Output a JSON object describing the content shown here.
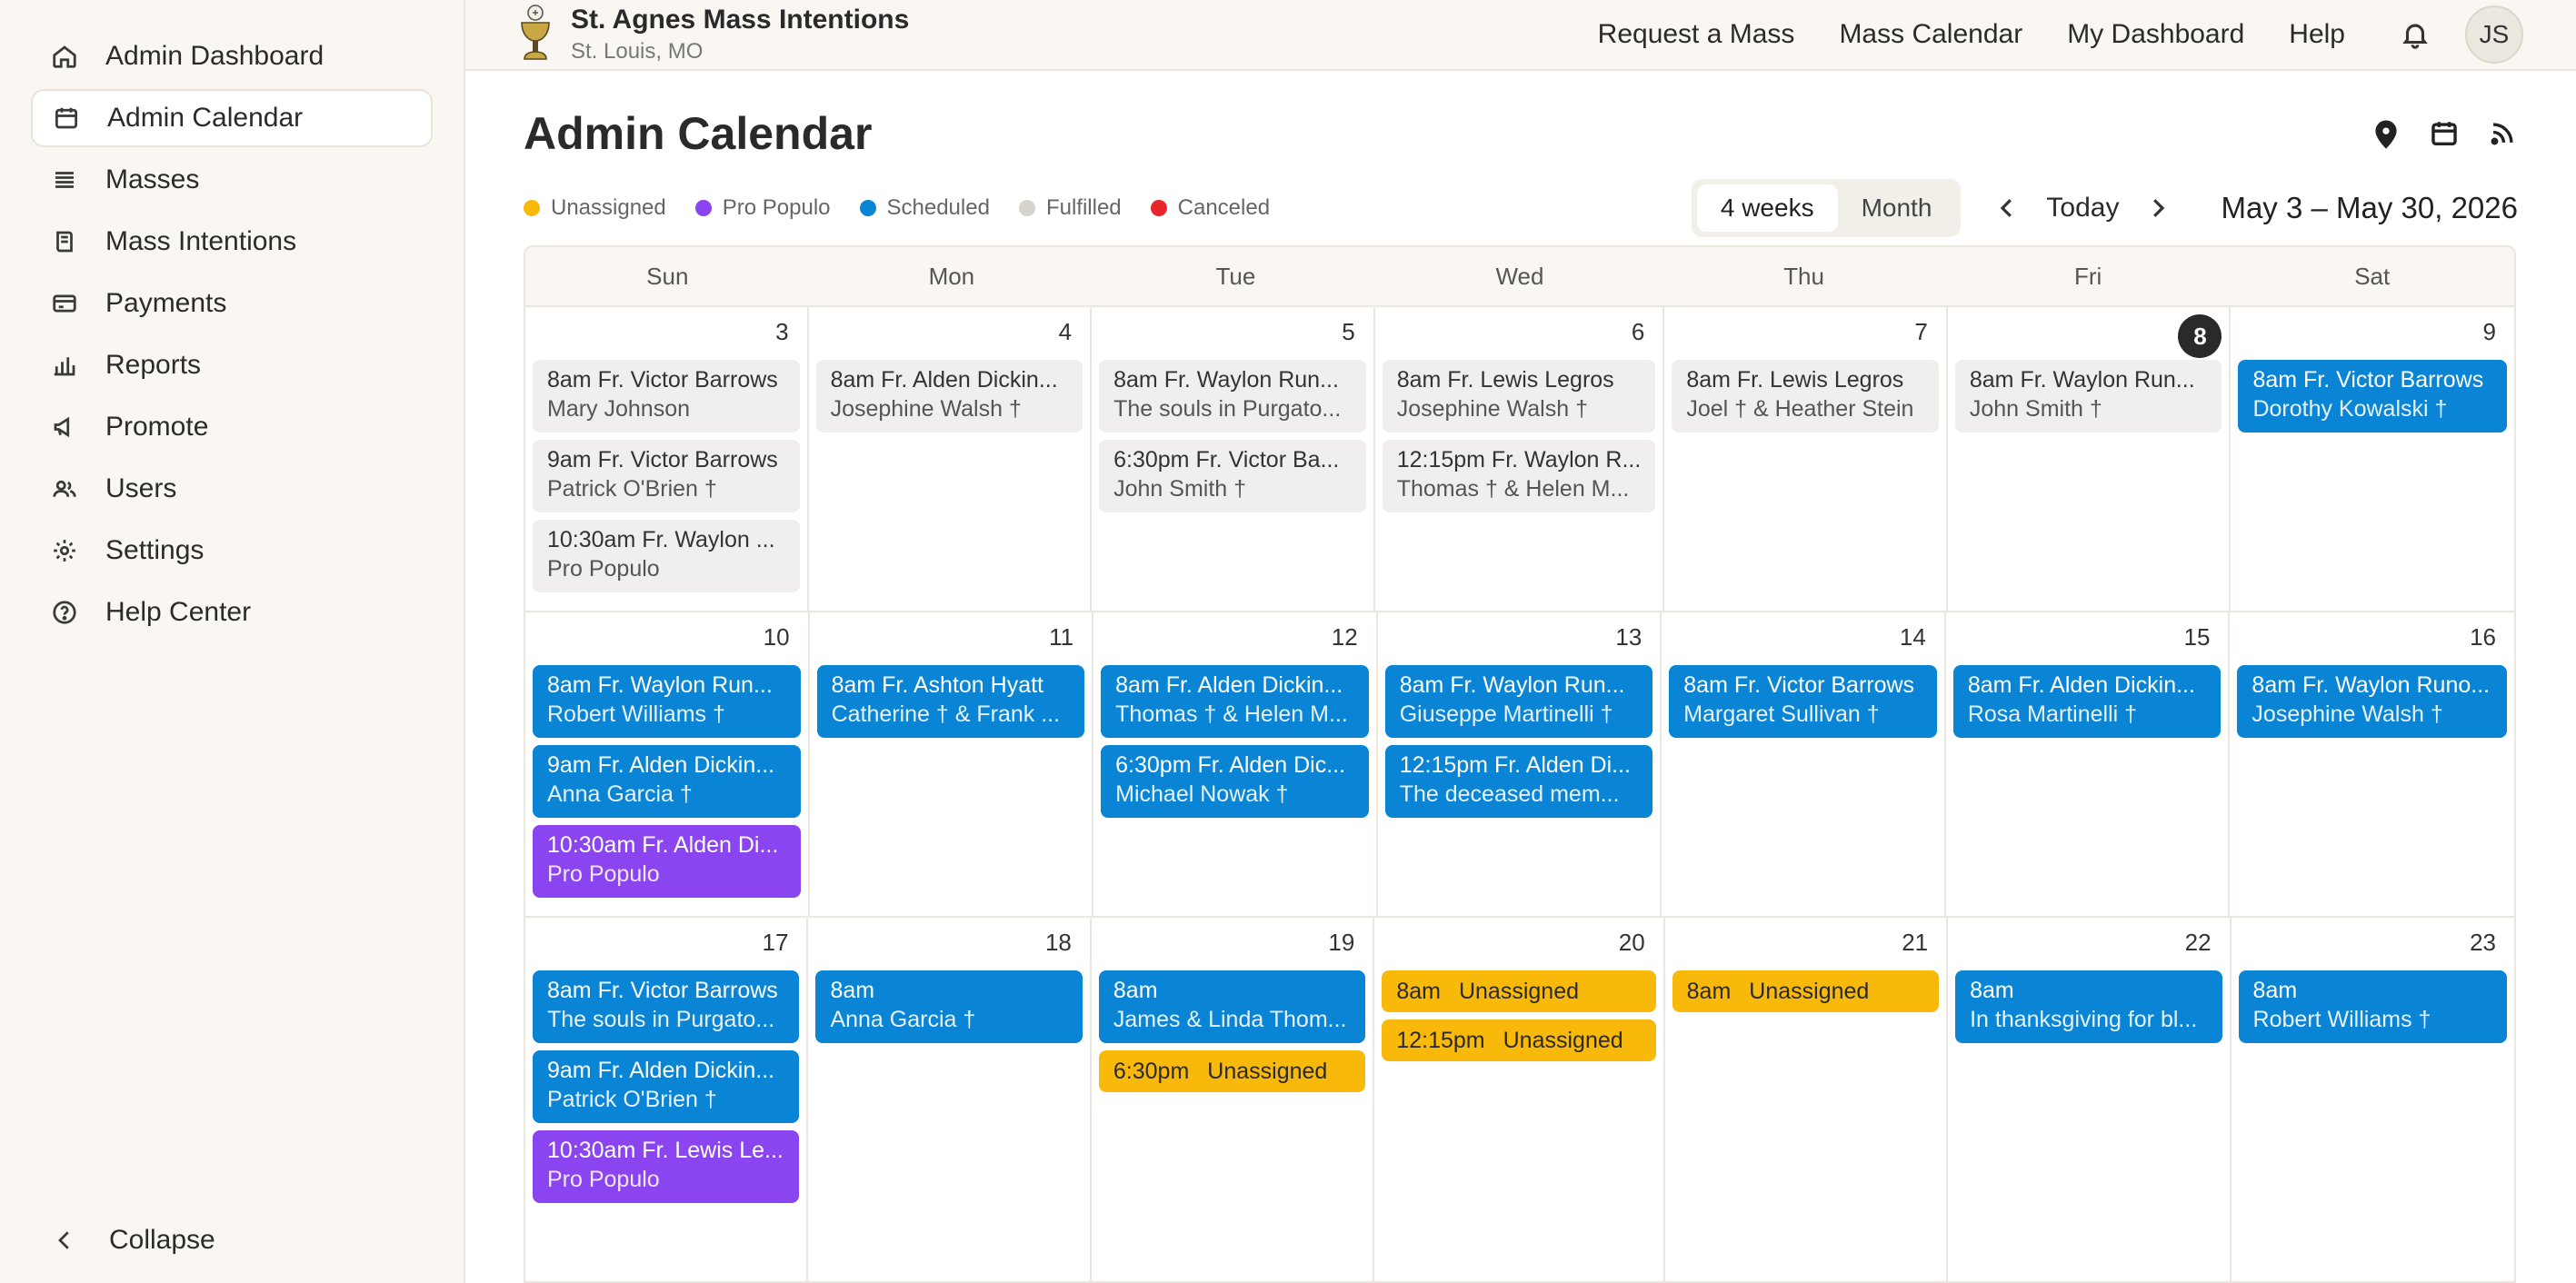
{
  "sidebar": {
    "items": [
      {
        "label": "Admin Dashboard",
        "icon": "home-icon"
      },
      {
        "label": "Admin Calendar",
        "icon": "calendar-icon"
      },
      {
        "label": "Masses",
        "icon": "list-icon"
      },
      {
        "label": "Mass Intentions",
        "icon": "book-icon"
      },
      {
        "label": "Payments",
        "icon": "credit-card-icon"
      },
      {
        "label": "Reports",
        "icon": "bar-chart-icon"
      },
      {
        "label": "Promote",
        "icon": "megaphone-icon"
      },
      {
        "label": "Users",
        "icon": "users-icon"
      },
      {
        "label": "Settings",
        "icon": "gear-icon"
      },
      {
        "label": "Help Center",
        "icon": "help-circle-icon"
      }
    ],
    "collapse_label": "Collapse"
  },
  "brand": {
    "title": "St. Agnes Mass Intentions",
    "subtitle": "St. Louis, MO"
  },
  "topnav": {
    "links": [
      "Request a Mass",
      "Mass Calendar",
      "My Dashboard",
      "Help"
    ],
    "avatar_initials": "JS"
  },
  "page": {
    "title": "Admin Calendar"
  },
  "legend": [
    {
      "label": "Unassigned",
      "color": "#f9b90a"
    },
    {
      "label": "Pro Populo",
      "color": "#8b45f0"
    },
    {
      "label": "Scheduled",
      "color": "#0a84d4"
    },
    {
      "label": "Fulfilled",
      "color": "#d6d3cc"
    },
    {
      "label": "Canceled",
      "color": "#e8262c"
    }
  ],
  "view": {
    "four_weeks": "4 weeks",
    "month": "Month",
    "today": "Today",
    "range": "May 3 – May 30, 2026"
  },
  "weekdays": [
    "Sun",
    "Mon",
    "Tue",
    "Wed",
    "Thu",
    "Fri",
    "Sat"
  ],
  "weeks": [
    [
      {
        "num": "3",
        "events": [
          {
            "color": "gray",
            "l1": "8am Fr. Victor Barrows",
            "l2": "Mary Johnson"
          },
          {
            "color": "gray",
            "l1": "9am Fr. Victor Barrows",
            "l2": "Patrick O'Brien †"
          },
          {
            "color": "gray",
            "l1": "10:30am Fr. Waylon ...",
            "l2": "Pro Populo"
          }
        ]
      },
      {
        "num": "4",
        "events": [
          {
            "color": "gray",
            "l1": "8am Fr. Alden Dickin...",
            "l2": "Josephine Walsh †"
          }
        ]
      },
      {
        "num": "5",
        "events": [
          {
            "color": "gray",
            "l1": "8am Fr. Waylon Run...",
            "l2": "The souls in Purgato..."
          },
          {
            "color": "gray",
            "l1": "6:30pm Fr. Victor Ba...",
            "l2": "John Smith †"
          }
        ]
      },
      {
        "num": "6",
        "events": [
          {
            "color": "gray",
            "l1": "8am Fr. Lewis Legros",
            "l2": "Josephine Walsh †"
          },
          {
            "color": "gray",
            "l1": "12:15pm Fr. Waylon R...",
            "l2": "Thomas † & Helen M..."
          }
        ]
      },
      {
        "num": "7",
        "events": [
          {
            "color": "gray",
            "l1": "8am Fr. Lewis Legros",
            "l2": "Joel † & Heather Stein"
          }
        ]
      },
      {
        "num": "8",
        "today": true,
        "events": [
          {
            "color": "gray",
            "l1": "8am Fr. Waylon Run...",
            "l2": "John Smith †"
          }
        ]
      },
      {
        "num": "9",
        "events": [
          {
            "color": "blue",
            "l1": "8am Fr. Victor Barrows",
            "l2": "Dorothy Kowalski †"
          }
        ]
      }
    ],
    [
      {
        "num": "10",
        "events": [
          {
            "color": "blue",
            "l1": "8am Fr. Waylon Run...",
            "l2": "Robert Williams †"
          },
          {
            "color": "blue",
            "l1": "9am Fr. Alden Dickin...",
            "l2": "Anna Garcia †"
          },
          {
            "color": "purple",
            "l1": "10:30am Fr. Alden Di...",
            "l2": "Pro Populo"
          }
        ]
      },
      {
        "num": "11",
        "events": [
          {
            "color": "blue",
            "l1": "8am Fr. Ashton Hyatt",
            "l2": "Catherine † & Frank ..."
          }
        ]
      },
      {
        "num": "12",
        "events": [
          {
            "color": "blue",
            "l1": "8am Fr. Alden Dickin...",
            "l2": "Thomas † & Helen M..."
          },
          {
            "color": "blue",
            "l1": "6:30pm Fr. Alden Dic...",
            "l2": "Michael Nowak †"
          }
        ]
      },
      {
        "num": "13",
        "events": [
          {
            "color": "blue",
            "l1": "8am Fr. Waylon Run...",
            "l2": "Giuseppe Martinelli †"
          },
          {
            "color": "blue",
            "l1": "12:15pm Fr. Alden Di...",
            "l2": "The deceased mem..."
          }
        ]
      },
      {
        "num": "14",
        "events": [
          {
            "color": "blue",
            "l1": "8am Fr. Victor Barrows",
            "l2": "Margaret Sullivan †"
          }
        ]
      },
      {
        "num": "15",
        "events": [
          {
            "color": "blue",
            "l1": "8am Fr. Alden Dickin...",
            "l2": "Rosa Martinelli †"
          }
        ]
      },
      {
        "num": "16",
        "events": [
          {
            "color": "blue",
            "l1": "8am Fr. Waylon Runo...",
            "l2": "Josephine Walsh †"
          }
        ]
      }
    ],
    [
      {
        "num": "17",
        "events": [
          {
            "color": "blue",
            "l1": "8am Fr. Victor Barrows",
            "l2": "The souls in Purgato..."
          },
          {
            "color": "blue",
            "l1": "9am Fr. Alden Dickin...",
            "l2": "Patrick O'Brien †"
          },
          {
            "color": "purple",
            "l1": "10:30am Fr. Lewis Le...",
            "l2": "Pro Populo"
          }
        ]
      },
      {
        "num": "18",
        "events": [
          {
            "color": "blue",
            "l1": "8am",
            "l2": "Anna Garcia †"
          }
        ]
      },
      {
        "num": "19",
        "events": [
          {
            "color": "blue",
            "l1": "8am",
            "l2": "James & Linda Thom..."
          },
          {
            "color": "yellow",
            "time": "6:30pm",
            "l1": "Unassigned"
          }
        ]
      },
      {
        "num": "20",
        "events": [
          {
            "color": "yellow",
            "time": "8am",
            "l1": "Unassigned"
          },
          {
            "color": "yellow",
            "time": "12:15pm",
            "l1": "Unassigned"
          }
        ]
      },
      {
        "num": "21",
        "events": [
          {
            "color": "yellow",
            "time": "8am",
            "l1": "Unassigned"
          }
        ]
      },
      {
        "num": "22",
        "events": [
          {
            "color": "blue",
            "l1": "8am",
            "l2": "In thanksgiving for bl..."
          }
        ]
      },
      {
        "num": "23",
        "events": [
          {
            "color": "blue",
            "l1": "8am",
            "l2": "Robert Williams †"
          }
        ]
      }
    ]
  ]
}
